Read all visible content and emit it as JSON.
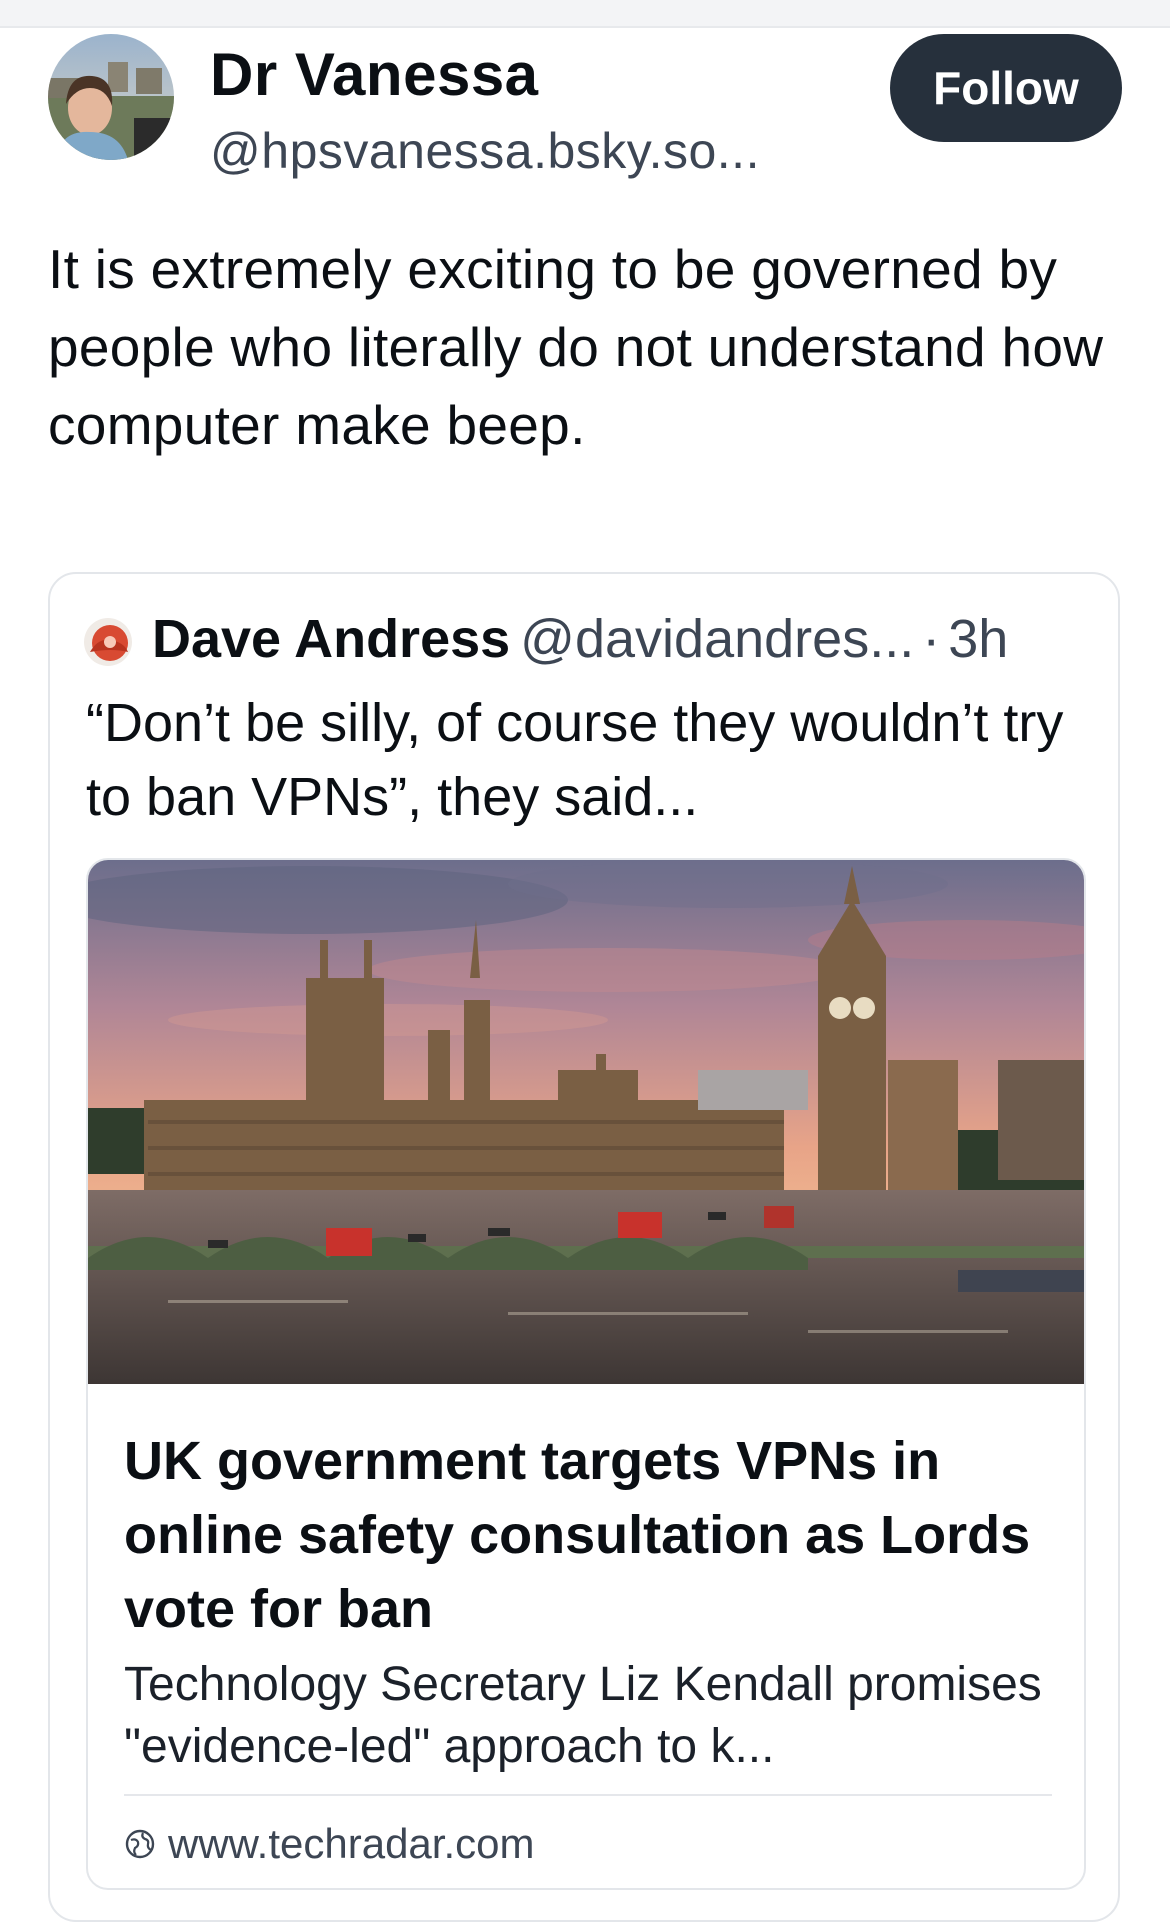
{
  "post": {
    "author_name": "Dr Vanessa",
    "author_handle": "@hpsvanessa.bsky.so...",
    "follow_label": "Follow",
    "text": "It is extremely exciting to be governed by people who literally do not understand how computer make beep."
  },
  "quoted_post": {
    "author_name": "Dave Andress",
    "author_handle": "@davidandres...",
    "separator": "·",
    "time": "3h",
    "text": "“Don’t be silly, of course they wouldn’t try to ban VPNs”, they said..."
  },
  "link_card": {
    "title": "UK government targets VPNs in online safety consultation as Lords vote for ban",
    "description": "Technology Secretary Liz Kendall promises \"evidence-led\" approach to k...",
    "domain": "www.techradar.com",
    "domain_icon": "globe-icon"
  },
  "colors": {
    "follow_button_bg": "#26303c",
    "secondary_text": "#3d4654",
    "border": "#e3e6ea"
  }
}
